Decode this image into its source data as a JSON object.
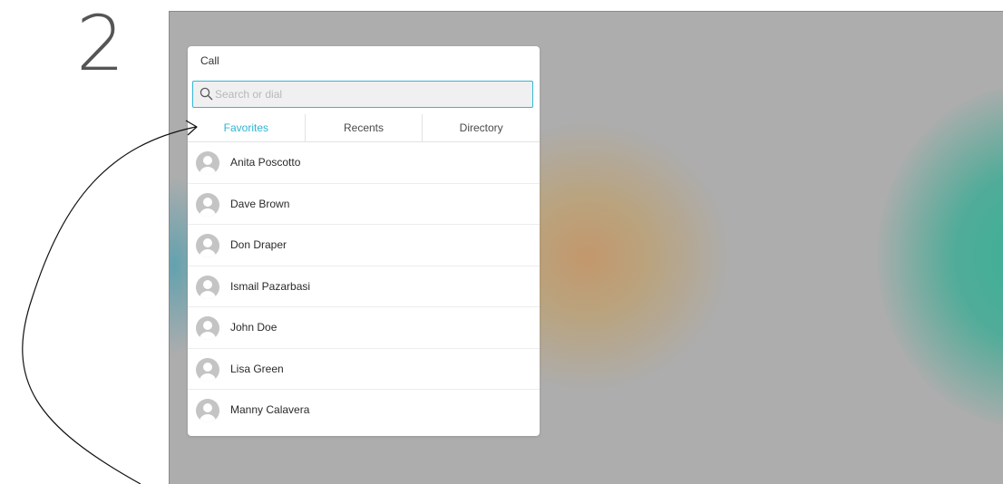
{
  "step": {
    "number": "2"
  },
  "dialog": {
    "title": "Call",
    "search": {
      "placeholder": "Search or dial",
      "value": ""
    },
    "tabs": [
      {
        "label": "Favorites",
        "active": true
      },
      {
        "label": "Recents",
        "active": false
      },
      {
        "label": "Directory",
        "active": false
      }
    ],
    "contacts": [
      {
        "name": "Anita Poscotto"
      },
      {
        "name": "Dave Brown"
      },
      {
        "name": "Don Draper"
      },
      {
        "name": "Ismail Pazarbasi"
      },
      {
        "name": "John Doe"
      },
      {
        "name": "Lisa Green"
      },
      {
        "name": "Manny Calavera"
      }
    ]
  },
  "colors": {
    "accent": "#2fb4d2",
    "screen_background": "#adadad",
    "avatar": "#c4c4c4"
  },
  "icons": {
    "search": "search-icon",
    "avatar": "person-avatar-icon",
    "annotation": "curved-arrow-icon"
  }
}
